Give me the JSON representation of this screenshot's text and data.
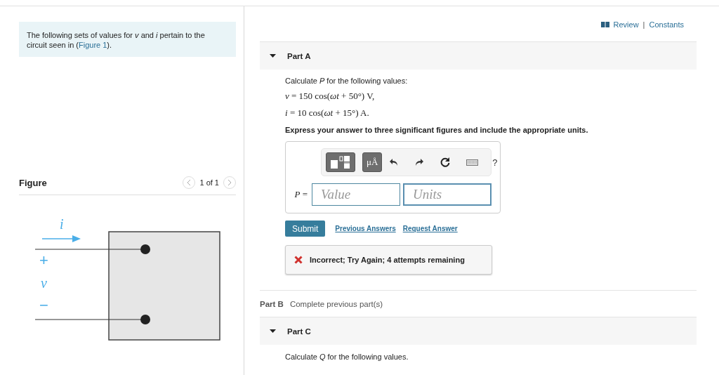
{
  "intro": {
    "text": "The following sets of values for *v* and *i* pertain to the circuit seen in (",
    "link": "Figure 1",
    "end": ")."
  },
  "figure": {
    "title": "Figure",
    "pager": "1 of 1",
    "labels": {
      "current": "i",
      "plus": "+",
      "voltage": "v",
      "minus": "−"
    }
  },
  "header_links": [
    "Review",
    "Constants"
  ],
  "header_separator": "|",
  "part_a": {
    "label": "Part A",
    "expanded": true,
    "prompt": "Calculate *P* for the following values:",
    "equations": [
      "*v* = 150 cos(*ωt* + 50°) V,",
      "*i* = 10 cos(*ωt* + 15°) A."
    ],
    "instruction": "Express your answer to three significant figures and include the appropriate units.",
    "toolbar": {
      "units_button": "μÅ",
      "help": "?"
    },
    "answer_label": "*P* =",
    "value_placeholder": "Value",
    "units_placeholder": "Units",
    "submit": "Submit",
    "links": [
      "Previous Answers",
      "Request Answer"
    ],
    "feedback": {
      "correct": false,
      "text": "Incorrect; Try Again; 4 attempts remaining"
    }
  },
  "part_b": {
    "label": "Part B",
    "status": "Complete previous part(s)"
  },
  "part_c": {
    "label": "Part C",
    "expanded": true,
    "prompt": "Calculate *Q* for the following values."
  }
}
